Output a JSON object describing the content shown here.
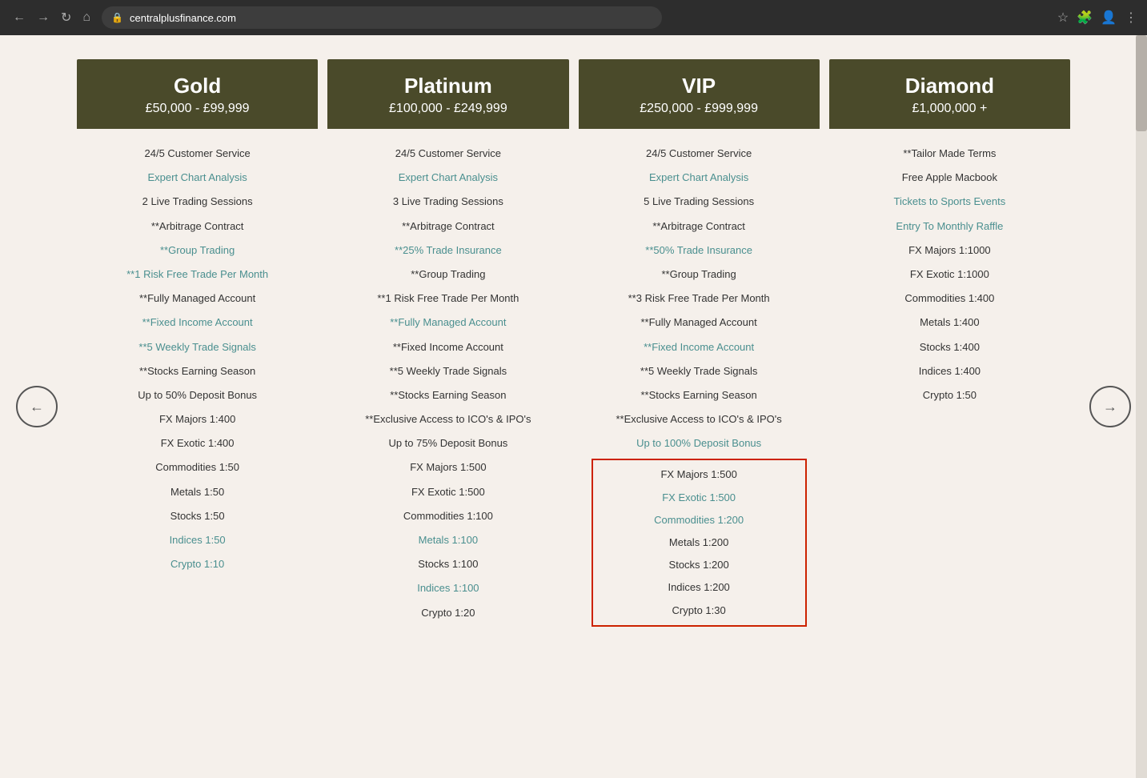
{
  "browser": {
    "url": "centralplusfinance.com",
    "back_label": "←",
    "forward_label": "→",
    "refresh_label": "↻",
    "home_label": "⌂"
  },
  "page": {
    "nav_left": "←",
    "nav_right": "→"
  },
  "plans": [
    {
      "id": "gold",
      "name": "Gold",
      "price_range": "£50,000 - £99,999",
      "features": [
        {
          "text": "24/5 Customer Service",
          "style": "dark"
        },
        {
          "text": "Expert Chart Analysis",
          "style": "teal"
        },
        {
          "text": "2 Live Trading Sessions",
          "style": "dark"
        },
        {
          "text": "**Arbitrage Contract",
          "style": "dark"
        },
        {
          "text": "**Group Trading",
          "style": "teal"
        },
        {
          "text": "**1 Risk Free Trade Per Month",
          "style": "teal"
        },
        {
          "text": "**Fully Managed Account",
          "style": "dark"
        },
        {
          "text": "**Fixed Income Account",
          "style": "teal"
        },
        {
          "text": "**5 Weekly Trade Signals",
          "style": "teal"
        },
        {
          "text": "**Stocks Earning Season",
          "style": "dark"
        },
        {
          "text": "Up to 50% Deposit Bonus",
          "style": "dark"
        },
        {
          "text": "FX Majors 1:400",
          "style": "dark"
        },
        {
          "text": "FX Exotic 1:400",
          "style": "dark"
        },
        {
          "text": "Commodities 1:50",
          "style": "dark"
        },
        {
          "text": "Metals 1:50",
          "style": "dark"
        },
        {
          "text": "Stocks 1:50",
          "style": "dark"
        },
        {
          "text": "Indices 1:50",
          "style": "teal"
        },
        {
          "text": "Crypto 1:10",
          "style": "teal"
        }
      ],
      "highlighted": false
    },
    {
      "id": "platinum",
      "name": "Platinum",
      "price_range": "£100,000 - £249,999",
      "features": [
        {
          "text": "24/5 Customer Service",
          "style": "dark"
        },
        {
          "text": "Expert Chart Analysis",
          "style": "teal"
        },
        {
          "text": "3 Live Trading Sessions",
          "style": "dark"
        },
        {
          "text": "**Arbitrage Contract",
          "style": "dark"
        },
        {
          "text": "**25% Trade Insurance",
          "style": "teal"
        },
        {
          "text": "**Group Trading",
          "style": "dark"
        },
        {
          "text": "**1 Risk Free Trade Per Month",
          "style": "dark"
        },
        {
          "text": "**Fully Managed Account",
          "style": "teal"
        },
        {
          "text": "**Fixed Income Account",
          "style": "dark"
        },
        {
          "text": "**5 Weekly Trade Signals",
          "style": "dark"
        },
        {
          "text": "**Stocks Earning Season",
          "style": "dark"
        },
        {
          "text": "**Exclusive Access to ICO's & IPO's",
          "style": "dark"
        },
        {
          "text": "Up to 75% Deposit Bonus",
          "style": "dark"
        },
        {
          "text": "FX Majors 1:500",
          "style": "dark"
        },
        {
          "text": "FX Exotic 1:500",
          "style": "dark"
        },
        {
          "text": "Commodities 1:100",
          "style": "dark"
        },
        {
          "text": "Metals 1:100",
          "style": "teal"
        },
        {
          "text": "Stocks 1:100",
          "style": "dark"
        },
        {
          "text": "Indices 1:100",
          "style": "teal"
        },
        {
          "text": "Crypto 1:20",
          "style": "dark"
        }
      ],
      "highlighted": false
    },
    {
      "id": "vip",
      "name": "VIP",
      "price_range": "£250,000 - £999,999",
      "features_top": [
        {
          "text": "24/5 Customer Service",
          "style": "dark"
        },
        {
          "text": "Expert Chart Analysis",
          "style": "teal"
        },
        {
          "text": "5 Live Trading Sessions",
          "style": "dark"
        },
        {
          "text": "**Arbitrage Contract",
          "style": "dark"
        },
        {
          "text": "**50% Trade Insurance",
          "style": "teal"
        },
        {
          "text": "**Group Trading",
          "style": "dark"
        },
        {
          "text": "**3 Risk Free Trade Per Month",
          "style": "dark"
        },
        {
          "text": "**Fully Managed Account",
          "style": "dark"
        },
        {
          "text": "**Fixed Income Account",
          "style": "teal"
        },
        {
          "text": "**5 Weekly Trade Signals",
          "style": "dark"
        },
        {
          "text": "**Stocks Earning Season",
          "style": "dark"
        },
        {
          "text": "**Exclusive Access to ICO's & IPO's",
          "style": "dark"
        },
        {
          "text": "Up to 100% Deposit Bonus",
          "style": "teal"
        }
      ],
      "features_highlighted": [
        {
          "text": "FX Majors 1:500",
          "style": "dark"
        },
        {
          "text": "FX Exotic 1:500",
          "style": "teal"
        },
        {
          "text": "Commodities 1:200",
          "style": "teal"
        },
        {
          "text": "Metals 1:200",
          "style": "dark"
        },
        {
          "text": "Stocks 1:200",
          "style": "dark"
        },
        {
          "text": "Indices 1:200",
          "style": "dark"
        },
        {
          "text": "Crypto 1:30",
          "style": "dark"
        }
      ],
      "highlighted": true
    },
    {
      "id": "diamond",
      "name": "Diamond",
      "price_range": "£1,000,000 +",
      "features": [
        {
          "text": "**Tailor Made Terms",
          "style": "dark"
        },
        {
          "text": "Free Apple Macbook",
          "style": "dark"
        },
        {
          "text": "Tickets to Sports Events",
          "style": "teal"
        },
        {
          "text": "Entry To Monthly Raffle",
          "style": "teal"
        },
        {
          "text": "FX Majors 1:1000",
          "style": "dark"
        },
        {
          "text": "FX Exotic 1:1000",
          "style": "dark"
        },
        {
          "text": "Commodities 1:400",
          "style": "dark"
        },
        {
          "text": "Metals 1:400",
          "style": "dark"
        },
        {
          "text": "Stocks 1:400",
          "style": "dark"
        },
        {
          "text": "Indices 1:400",
          "style": "dark"
        },
        {
          "text": "Crypto 1:50",
          "style": "dark"
        }
      ],
      "highlighted": false
    }
  ]
}
